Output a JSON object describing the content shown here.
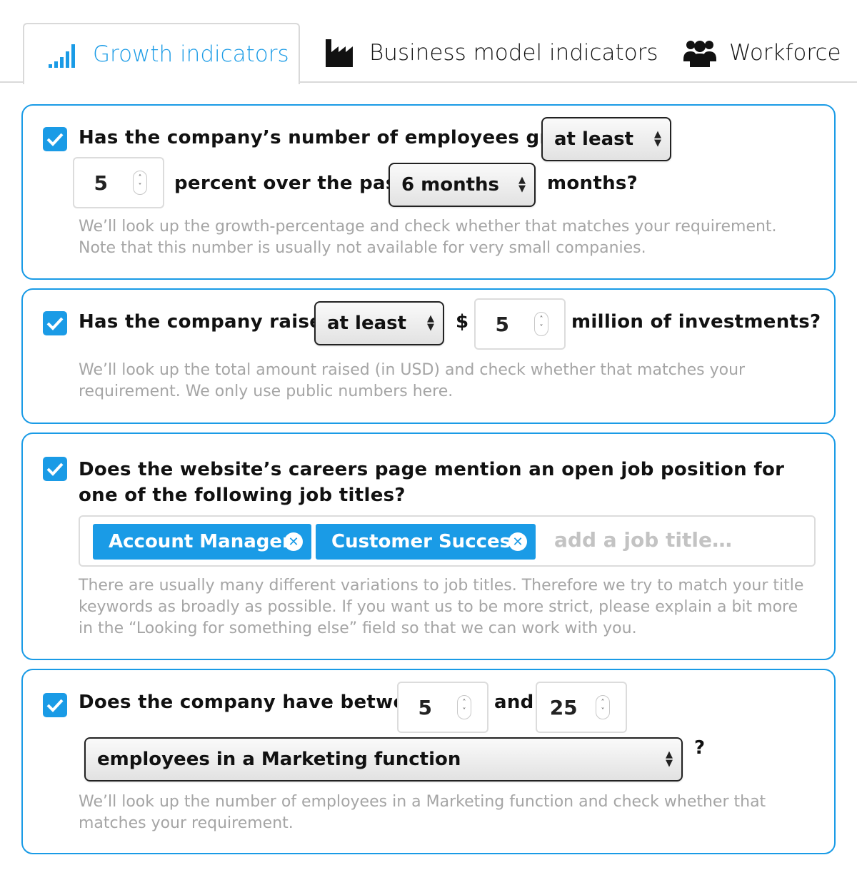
{
  "tabs": [
    {
      "label": "Growth indicators",
      "icon": "signal-bars-icon",
      "active": true
    },
    {
      "label": "Business model indicators",
      "icon": "factory-icon",
      "active": false
    },
    {
      "label": "Workforce",
      "icon": "users-icon",
      "active": false
    }
  ],
  "colors": {
    "accent": "#1a9be6",
    "help_text": "#a5a5a5",
    "border": "#d9d9d9"
  },
  "card1": {
    "checked": true,
    "q_part1": "Has the company’s number of employees grown",
    "comparator": "at least",
    "percent_value": "5",
    "q_part2": "percent over the past",
    "period": "6 months",
    "q_part3": "months?",
    "help": "We’ll look up the growth-percentage and check whether that matches your requirement. Note that this number is usually not available for very small companies."
  },
  "card2": {
    "checked": true,
    "q_part1": "Has the company raised",
    "comparator": "at least",
    "currency": "$",
    "amount_value": "5",
    "q_part2": "million of investments?",
    "help": "We’ll look up the total amount raised (in USD) and check whether that matches your requirement. We only use public numbers here."
  },
  "card3": {
    "checked": true,
    "question": "Does the website’s careers page mention an open job position for one of the following job titles?",
    "tags": [
      "Account Manager",
      "Customer Success"
    ],
    "placeholder": "add a job title…",
    "help": "There are usually many different variations to job titles. Therefore we try to match your title keywords as broadly as possible. If you want us to be more strict, please explain a bit more in the “Looking for something else” field so that we can work with you."
  },
  "card4": {
    "checked": true,
    "q_part1": "Does the company have between",
    "min_value": "5",
    "and_label": "and",
    "max_value": "25",
    "function_select": "employees in a Marketing function",
    "question_mark": "?",
    "help": "We’ll look up the number of employees in a Marketing function and check whether that matches your requirement."
  }
}
